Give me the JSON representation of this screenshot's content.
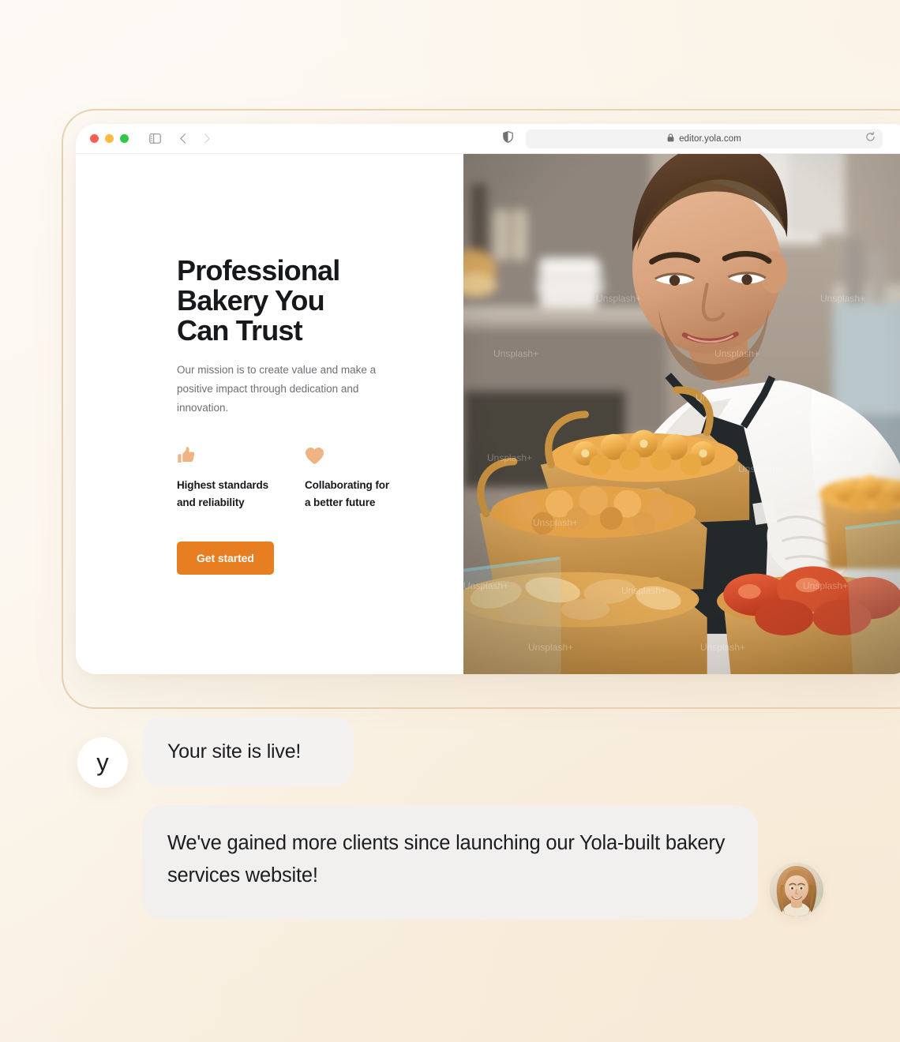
{
  "browser": {
    "traffic_lights": [
      {
        "name": "close",
        "color": "#fb5f57"
      },
      {
        "name": "minimize",
        "color": "#fcbb40"
      },
      {
        "name": "maximize",
        "color": "#33c748"
      }
    ],
    "sidebar_icon": "sidebar-toggle-icon",
    "back_icon": "chevron-left-icon",
    "forward_icon": "chevron-right-icon",
    "shield_icon": "privacy-shield-icon",
    "lock_icon": "lock-icon",
    "url": "editor.yola.com",
    "reload_icon": "reload-icon"
  },
  "hero": {
    "title": "Professional\nBakery You\nCan Trust",
    "subtitle": "Our mission is to create value and make a positive impact through dedication and innovation.",
    "features": [
      {
        "icon": "thumbs-up-icon",
        "label": "Highest standards\nand reliability"
      },
      {
        "icon": "heart-icon",
        "label": "Collaborating for\na better future"
      }
    ],
    "cta_label": "Get started",
    "photo_alt": "baker-arranging-pastry-baskets",
    "photo_watermark": "Unsplash+"
  },
  "chat": {
    "bot_avatar_letter": "y",
    "status_message": "Your site is live!",
    "testimonial_message": "We've gained more clients since launching our Yola-built bakery services website!",
    "user_avatar_alt": "smiling-woman-portrait"
  },
  "colors": {
    "accent_orange": "#e87e22",
    "icon_peach": "#f0b484",
    "frame_tan": "#e9d3b3",
    "bubble_gray": "#f2f1ef",
    "background_cream": "#faf4ea"
  }
}
